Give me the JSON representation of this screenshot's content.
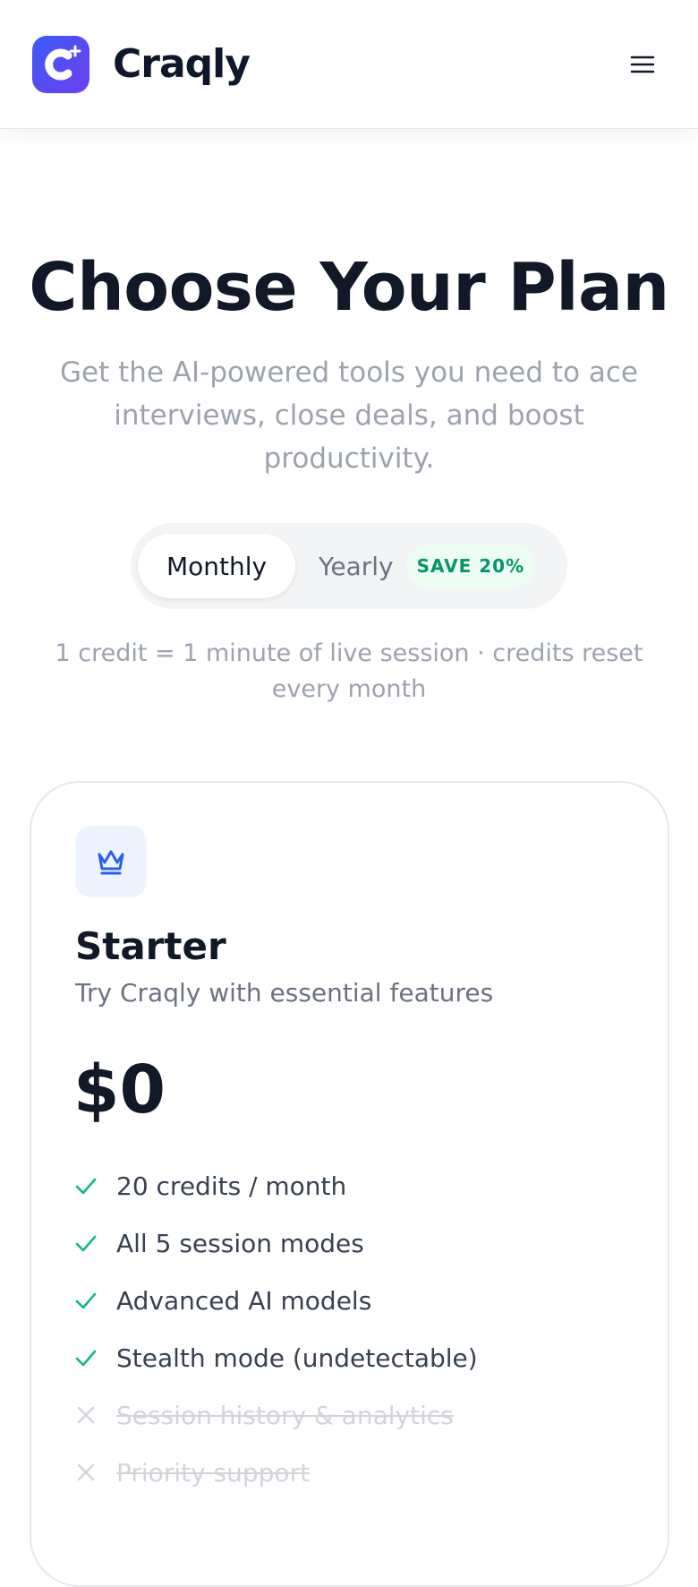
{
  "header": {
    "brand_name": "Craqly",
    "logo_icon": "craqly-logo-icon",
    "menu_icon": "hamburger-menu-icon"
  },
  "hero": {
    "title": "Choose Your Plan",
    "subtitle": "Get the AI-powered tools you need to ace interviews, close deals, and boost productivity."
  },
  "billing_toggle": {
    "monthly_label": "Monthly",
    "yearly_label": "Yearly",
    "save_badge": "SAVE 20%",
    "selected": "Monthly"
  },
  "credit_note": "1 credit = 1 minute of live session · credits reset every month",
  "plans": [
    {
      "icon": "crown-icon",
      "name": "Starter",
      "description": "Try Craqly with essential features",
      "price": "$0",
      "features": [
        {
          "text": "20 credits / month",
          "included": true
        },
        {
          "text": "All 5 session modes",
          "included": true
        },
        {
          "text": "Advanced AI models",
          "included": true
        },
        {
          "text": "Stealth mode (undetectable)",
          "included": true
        },
        {
          "text": "Session history & analytics",
          "included": false
        },
        {
          "text": "Priority support",
          "included": false
        }
      ]
    }
  ],
  "colors": {
    "brand_gradient_start": "#3b5bf6",
    "brand_gradient_end": "#6d3ff0",
    "included_check": "#10b981",
    "excluded_x": "#d1d5db",
    "save_badge_text": "#059669",
    "save_badge_bg": "#ecfdf3",
    "plan_icon_color": "#2563eb"
  }
}
